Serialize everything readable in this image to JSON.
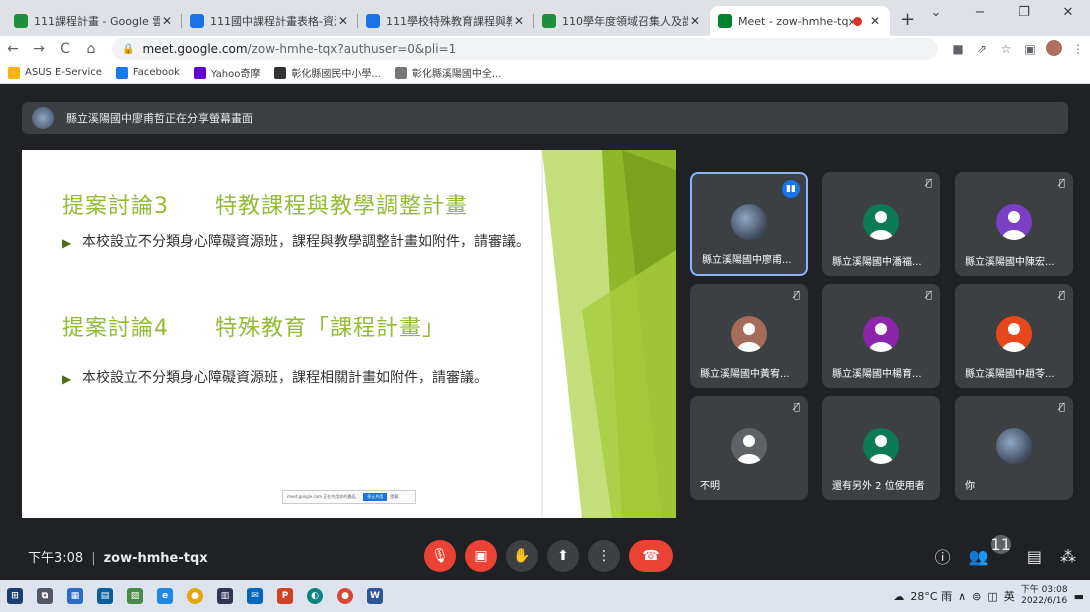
{
  "browser": {
    "tabs": [
      {
        "title": "111課程計畫 - Google 雲端",
        "color": "#1e8e3e",
        "icon": "drive-icon"
      },
      {
        "title": "111國中課程計畫表格-資源班",
        "color": "#1a73e8",
        "icon": "docs-icon"
      },
      {
        "title": "111學校特殊教育課程與教學",
        "color": "#1a73e8",
        "icon": "docs-icon"
      },
      {
        "title": "110學年度領域召集人及課發",
        "color": "#1e8e3e",
        "icon": "sheets-icon"
      },
      {
        "title": "Meet - zow-hmhe-tqx",
        "color": "#00832d",
        "icon": "meet-icon",
        "active": true
      }
    ],
    "new_tab": "+",
    "window_controls": [
      "⌄",
      "−",
      "❐",
      "✕"
    ],
    "url_host": "meet.google.com",
    "url_path": "/zow-hmhe-tqx?authuser=0&pli=1",
    "bookmarks": [
      {
        "label": "ASUS E-Service",
        "color": "#f4b400"
      },
      {
        "label": "Facebook",
        "color": "#1877f2"
      },
      {
        "label": "Yahoo奇摩",
        "color": "#6001d2"
      },
      {
        "label": "彰化縣國民中小學...",
        "color": "#333"
      },
      {
        "label": "彰化縣溪陽國中全...",
        "color": "#777"
      }
    ]
  },
  "meet": {
    "banner_text": "縣立溪陽國中廖甫哲正在分享螢幕畫面",
    "slide": {
      "heading1": "提案討論3　　特教課程與教學調整計畫",
      "bullet1": "本校設立不分類身心障礙資源班，課程與教學調整計畫如附件，請審議。",
      "heading2": "提案討論4　　特殊教育「課程計畫」",
      "bullet2": "本校設立不分類身心障礙資源班，課程相關計畫如附件，請審議。",
      "share_text": "meet.google.com 正在共用你的畫面。",
      "share_stop": "停止共用",
      "share_hide": "隱藏"
    },
    "participants": [
      {
        "name": "縣立溪陽國中廖甫...",
        "avatar_color": "photo",
        "speaking": true
      },
      {
        "name": "縣立溪陽國中潘福...",
        "avatar_color": "#0b7a55",
        "muted": true
      },
      {
        "name": "縣立溪陽國中陳宏...",
        "avatar_color": "#7b3fc4",
        "muted": true
      },
      {
        "name": "縣立溪陽國中黃宥...",
        "avatar_color": "#a56b5b",
        "muted": true
      },
      {
        "name": "縣立溪陽國中楊育...",
        "avatar_color": "#8e24aa",
        "muted": true
      },
      {
        "name": "縣立溪陽國中趙苓...",
        "avatar_color": "#e8471c",
        "muted": true
      },
      {
        "name": "不明",
        "avatar_color": "#5f6368",
        "muted": true
      },
      {
        "name": "還有另外 2 位使用者",
        "avatar_color": "#0b7a55"
      },
      {
        "name": "你",
        "avatar_color": "photo",
        "muted": true
      }
    ],
    "time": "下午3:08",
    "meeting_code": "zow-hmhe-tqx",
    "participant_count": "11"
  },
  "taskbar": {
    "weather": "28°C 雨",
    "ime": "英",
    "time": "下午 03:08",
    "date": "2022/6/16"
  }
}
